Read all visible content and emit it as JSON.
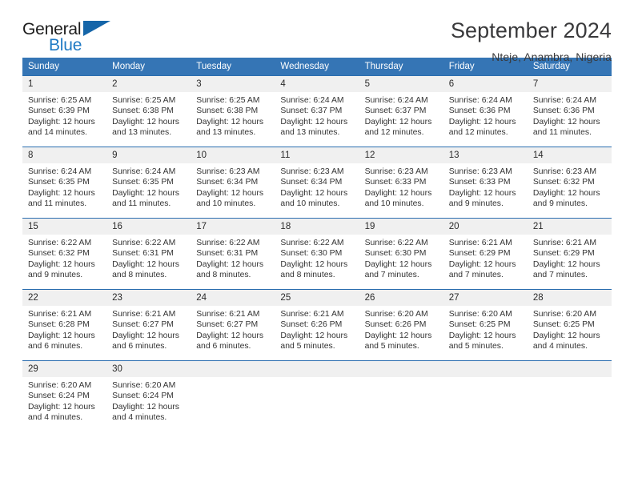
{
  "brand": {
    "word_one": "General",
    "word_two": "Blue"
  },
  "header": {
    "title": "September 2024",
    "subtitle": "Nteje, Anambra, Nigeria"
  },
  "weekday_headers": [
    "Sunday",
    "Monday",
    "Tuesday",
    "Wednesday",
    "Thursday",
    "Friday",
    "Saturday"
  ],
  "colors": {
    "header_blue": "#3575b5",
    "rule_blue": "#2a6daf",
    "daynum_bg": "#f0f0f0",
    "brand_blue": "#1f7ac4",
    "text": "#333333"
  },
  "weeks": [
    [
      {
        "day": "1",
        "sunrise": "Sunrise: 6:25 AM",
        "sunset": "Sunset: 6:39 PM",
        "daylight": "Daylight: 12 hours and 14 minutes."
      },
      {
        "day": "2",
        "sunrise": "Sunrise: 6:25 AM",
        "sunset": "Sunset: 6:38 PM",
        "daylight": "Daylight: 12 hours and 13 minutes."
      },
      {
        "day": "3",
        "sunrise": "Sunrise: 6:25 AM",
        "sunset": "Sunset: 6:38 PM",
        "daylight": "Daylight: 12 hours and 13 minutes."
      },
      {
        "day": "4",
        "sunrise": "Sunrise: 6:24 AM",
        "sunset": "Sunset: 6:37 PM",
        "daylight": "Daylight: 12 hours and 13 minutes."
      },
      {
        "day": "5",
        "sunrise": "Sunrise: 6:24 AM",
        "sunset": "Sunset: 6:37 PM",
        "daylight": "Daylight: 12 hours and 12 minutes."
      },
      {
        "day": "6",
        "sunrise": "Sunrise: 6:24 AM",
        "sunset": "Sunset: 6:36 PM",
        "daylight": "Daylight: 12 hours and 12 minutes."
      },
      {
        "day": "7",
        "sunrise": "Sunrise: 6:24 AM",
        "sunset": "Sunset: 6:36 PM",
        "daylight": "Daylight: 12 hours and 11 minutes."
      }
    ],
    [
      {
        "day": "8",
        "sunrise": "Sunrise: 6:24 AM",
        "sunset": "Sunset: 6:35 PM",
        "daylight": "Daylight: 12 hours and 11 minutes."
      },
      {
        "day": "9",
        "sunrise": "Sunrise: 6:24 AM",
        "sunset": "Sunset: 6:35 PM",
        "daylight": "Daylight: 12 hours and 11 minutes."
      },
      {
        "day": "10",
        "sunrise": "Sunrise: 6:23 AM",
        "sunset": "Sunset: 6:34 PM",
        "daylight": "Daylight: 12 hours and 10 minutes."
      },
      {
        "day": "11",
        "sunrise": "Sunrise: 6:23 AM",
        "sunset": "Sunset: 6:34 PM",
        "daylight": "Daylight: 12 hours and 10 minutes."
      },
      {
        "day": "12",
        "sunrise": "Sunrise: 6:23 AM",
        "sunset": "Sunset: 6:33 PM",
        "daylight": "Daylight: 12 hours and 10 minutes."
      },
      {
        "day": "13",
        "sunrise": "Sunrise: 6:23 AM",
        "sunset": "Sunset: 6:33 PM",
        "daylight": "Daylight: 12 hours and 9 minutes."
      },
      {
        "day": "14",
        "sunrise": "Sunrise: 6:23 AM",
        "sunset": "Sunset: 6:32 PM",
        "daylight": "Daylight: 12 hours and 9 minutes."
      }
    ],
    [
      {
        "day": "15",
        "sunrise": "Sunrise: 6:22 AM",
        "sunset": "Sunset: 6:32 PM",
        "daylight": "Daylight: 12 hours and 9 minutes."
      },
      {
        "day": "16",
        "sunrise": "Sunrise: 6:22 AM",
        "sunset": "Sunset: 6:31 PM",
        "daylight": "Daylight: 12 hours and 8 minutes."
      },
      {
        "day": "17",
        "sunrise": "Sunrise: 6:22 AM",
        "sunset": "Sunset: 6:31 PM",
        "daylight": "Daylight: 12 hours and 8 minutes."
      },
      {
        "day": "18",
        "sunrise": "Sunrise: 6:22 AM",
        "sunset": "Sunset: 6:30 PM",
        "daylight": "Daylight: 12 hours and 8 minutes."
      },
      {
        "day": "19",
        "sunrise": "Sunrise: 6:22 AM",
        "sunset": "Sunset: 6:30 PM",
        "daylight": "Daylight: 12 hours and 7 minutes."
      },
      {
        "day": "20",
        "sunrise": "Sunrise: 6:21 AM",
        "sunset": "Sunset: 6:29 PM",
        "daylight": "Daylight: 12 hours and 7 minutes."
      },
      {
        "day": "21",
        "sunrise": "Sunrise: 6:21 AM",
        "sunset": "Sunset: 6:29 PM",
        "daylight": "Daylight: 12 hours and 7 minutes."
      }
    ],
    [
      {
        "day": "22",
        "sunrise": "Sunrise: 6:21 AM",
        "sunset": "Sunset: 6:28 PM",
        "daylight": "Daylight: 12 hours and 6 minutes."
      },
      {
        "day": "23",
        "sunrise": "Sunrise: 6:21 AM",
        "sunset": "Sunset: 6:27 PM",
        "daylight": "Daylight: 12 hours and 6 minutes."
      },
      {
        "day": "24",
        "sunrise": "Sunrise: 6:21 AM",
        "sunset": "Sunset: 6:27 PM",
        "daylight": "Daylight: 12 hours and 6 minutes."
      },
      {
        "day": "25",
        "sunrise": "Sunrise: 6:21 AM",
        "sunset": "Sunset: 6:26 PM",
        "daylight": "Daylight: 12 hours and 5 minutes."
      },
      {
        "day": "26",
        "sunrise": "Sunrise: 6:20 AM",
        "sunset": "Sunset: 6:26 PM",
        "daylight": "Daylight: 12 hours and 5 minutes."
      },
      {
        "day": "27",
        "sunrise": "Sunrise: 6:20 AM",
        "sunset": "Sunset: 6:25 PM",
        "daylight": "Daylight: 12 hours and 5 minutes."
      },
      {
        "day": "28",
        "sunrise": "Sunrise: 6:20 AM",
        "sunset": "Sunset: 6:25 PM",
        "daylight": "Daylight: 12 hours and 4 minutes."
      }
    ],
    [
      {
        "day": "29",
        "sunrise": "Sunrise: 6:20 AM",
        "sunset": "Sunset: 6:24 PM",
        "daylight": "Daylight: 12 hours and 4 minutes."
      },
      {
        "day": "30",
        "sunrise": "Sunrise: 6:20 AM",
        "sunset": "Sunset: 6:24 PM",
        "daylight": "Daylight: 12 hours and 4 minutes."
      },
      {
        "day": "",
        "sunrise": "",
        "sunset": "",
        "daylight": ""
      },
      {
        "day": "",
        "sunrise": "",
        "sunset": "",
        "daylight": ""
      },
      {
        "day": "",
        "sunrise": "",
        "sunset": "",
        "daylight": ""
      },
      {
        "day": "",
        "sunrise": "",
        "sunset": "",
        "daylight": ""
      },
      {
        "day": "",
        "sunrise": "",
        "sunset": "",
        "daylight": ""
      }
    ]
  ]
}
